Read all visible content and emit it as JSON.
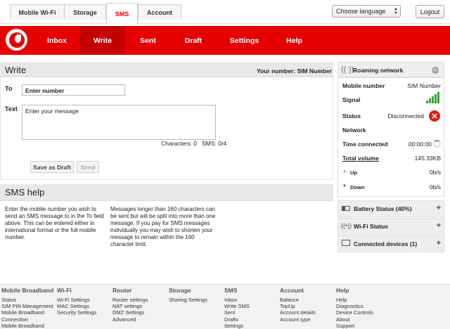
{
  "top_tabs": [
    "Mobile Wi-Fi",
    "Storage",
    "SMS",
    "Account"
  ],
  "language": "Choose language",
  "logout": "Logout",
  "nav": [
    "Inbox",
    "Write",
    "Sent",
    "Draft",
    "Settings",
    "Help"
  ],
  "write": {
    "title": "Write",
    "your_number": "Your number: SIM Number",
    "to_label": "To",
    "to_value": "Enter number",
    "text_label": "Text",
    "text_value": "Enter your message",
    "counters": "Characters: 0   SMS: 0/4",
    "save_draft": "Save as Draft",
    "send": "Send"
  },
  "help": {
    "title": "SMS help",
    "left": "Enter the mobile number you wish to send an SMS message to in the To field above. This can be entered either in international format or the full mobile number.",
    "right": "Messages longer than 160 characters can be sent but will be split into more than one message. If you pay for SMS messages individually you may wish to shorten your message to remain within the 160 character limit."
  },
  "sidebar": {
    "roaming_title": "Roaming network",
    "mobile_number_label": "Mobile number",
    "mobile_number_value": "SIM Number",
    "signal_label": "Signal",
    "status_label": "Status",
    "status_value": "Disconnected",
    "network_label": "Network",
    "time_connected_label": "Time connected",
    "time_connected_value": "00:00:00",
    "total_volume_label": "Total volume",
    "total_volume_value": "145.33KB",
    "up_label": "Up",
    "up_value": "0b/s",
    "down_label": "Down",
    "down_value": "0b/s",
    "battery": "Battery Status (40%)",
    "wifi": "Wi-Fi Status",
    "devices": "Connected devices (1)",
    "plus": "+"
  },
  "footer": [
    {
      "title": "Mobile Broadband",
      "links": [
        "Status",
        "SIM PIN Management",
        "Mobile Broadband Connection",
        "Mobile Broadband"
      ]
    },
    {
      "title": "Wi-Fi",
      "links": [
        "Wi-Fi Settings",
        "MAC Settings",
        "Security Settings"
      ]
    },
    {
      "title": "Router",
      "links": [
        "Router settings",
        "NAT settings",
        "DMZ Settings",
        "Advanced"
      ]
    },
    {
      "title": "Storage",
      "links": [
        "Sharing Settings"
      ]
    },
    {
      "title": "SMS",
      "links": [
        "Inbox",
        "Write SMS",
        "Sent",
        "Drafts",
        "Settings"
      ]
    },
    {
      "title": "Account",
      "links": [
        "Balance",
        "TopUp",
        "Account details",
        "Account type"
      ]
    },
    {
      "title": "Help",
      "links": [
        "Help",
        "Diagnostics",
        "Device Controls",
        "About",
        "Support"
      ]
    }
  ],
  "colors": {
    "brand_red": "#e60000",
    "nav_active": "#c40000",
    "signal_green": "#3aa53a"
  }
}
